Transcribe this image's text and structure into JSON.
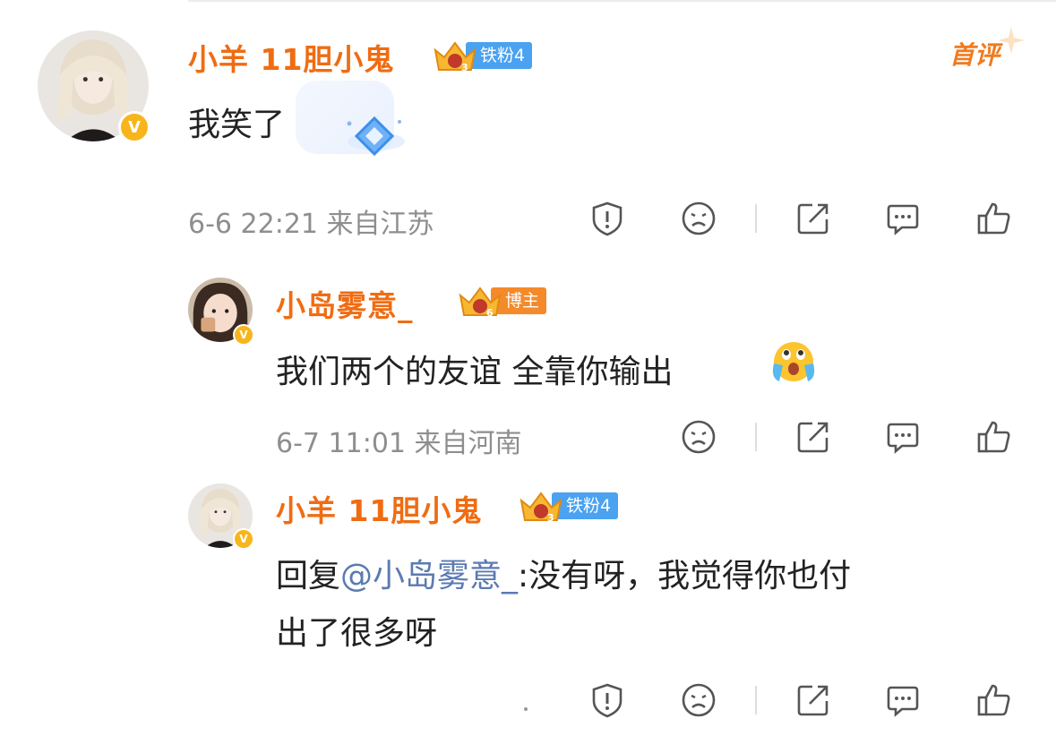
{
  "comment_main": {
    "username": "小羊 11胆小鬼",
    "fan_badge": "铁粉4",
    "first_comment_label": "首评",
    "text": "我笑了",
    "meta": "6-6 22:21 来自江苏"
  },
  "reply_1": {
    "username": "小岛雾意_",
    "fan_badge": "博主",
    "text": "我们两个的友谊 全靠你输出",
    "meta": "6-7 11:01 来自河南"
  },
  "reply_2": {
    "username": "小羊 11胆小鬼",
    "fan_badge": "铁粉4",
    "reply_prefix": "回复",
    "mention": "@小岛雾意_",
    "text_line1": ":没有呀，我觉得你也付",
    "text_line2": "出了很多呀"
  },
  "icons": {
    "report": "report-icon",
    "dislike": "dislike-face-icon",
    "share": "share-icon",
    "comment": "comment-icon",
    "like": "thumbs-up-icon",
    "verified": "verified-v-badge-icon",
    "crown": "fan-crown-icon",
    "emoji": "crying-emoji-icon"
  },
  "colors": {
    "username": "#f06c12",
    "fan_badge_blue": "#4aa2f0",
    "blogger_badge": "#f48a2a",
    "mention": "#5b7ab2",
    "meta": "#8e8e8e",
    "verified": "#f8b51b"
  }
}
